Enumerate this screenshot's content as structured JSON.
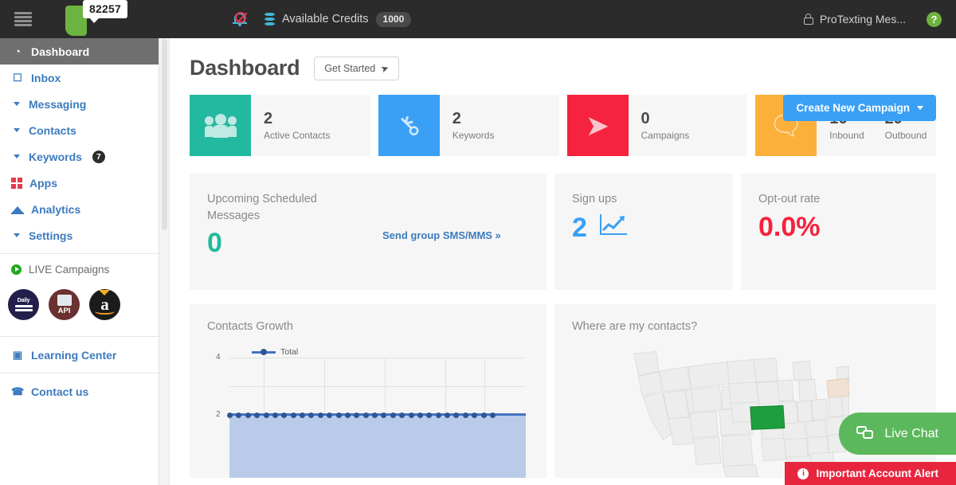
{
  "topbar": {
    "menu_icon": "hamburger-icon",
    "logo_tooltip": "82257",
    "notifications_icon": "bell-muted-icon",
    "credits_icon": "database-icon",
    "credits_label": "Available Credits",
    "credits_value": "1000",
    "account_icon": "lock-icon",
    "account_name": "ProTexting Mes...",
    "help_icon": "help-circle-icon",
    "help_label": "?"
  },
  "sidebar": {
    "items": [
      {
        "label": "Dashboard",
        "icon": "dashboard-icon",
        "active": true
      },
      {
        "label": "Inbox",
        "icon": "inbox-icon",
        "active": false
      },
      {
        "label": "Messaging",
        "icon": "caret-down-icon",
        "active": false
      },
      {
        "label": "Contacts",
        "icon": "caret-down-icon",
        "active": false
      },
      {
        "label": "Keywords",
        "icon": "caret-down-icon",
        "badge": "7",
        "active": false
      },
      {
        "label": "Apps",
        "icon": "apps-grid-icon",
        "active": false
      },
      {
        "label": "Analytics",
        "icon": "analytics-icon",
        "active": false
      },
      {
        "label": "Settings",
        "icon": "caret-down-icon",
        "active": false
      }
    ],
    "live_campaigns": {
      "title": "LIVE Campaigns",
      "icon": "play-circle-icon",
      "campaigns": [
        {
          "name": "daily-campaign-avatar",
          "label": "Daily"
        },
        {
          "name": "api-campaign-avatar",
          "label": "API"
        },
        {
          "name": "amazon-campaign-avatar",
          "label": "a"
        }
      ]
    },
    "learning_center": {
      "label": "Learning Center",
      "icon": "projector-icon"
    },
    "contact_us": {
      "label": "Contact us",
      "icon": "phone-icon"
    }
  },
  "main": {
    "title": "Dashboard",
    "get_started_label": "Get Started",
    "get_started_icon": "rocket-icon",
    "create_campaign_label": "Create New Campaign",
    "stats": [
      {
        "icon": "people-icon",
        "color": "#22b9a0",
        "value": "2",
        "label": "Active Contacts"
      },
      {
        "icon": "key-icon",
        "color": "#3aa0f5",
        "value": "2",
        "label": "Keywords"
      },
      {
        "icon": "paper-plane-icon",
        "color": "#f5233f",
        "value": "0",
        "label": "Campaigns"
      },
      {
        "icon": "chat-bubbles-icon",
        "color": "#fbb03b",
        "value_inbound": "16",
        "label_inbound": "Inbound",
        "value_outbound": "29",
        "label_outbound": "Outbound"
      }
    ],
    "scheduled": {
      "label": "Upcoming Scheduled Messages",
      "value": "0",
      "link_label": "Send group SMS/MMS »"
    },
    "signups": {
      "label": "Sign ups",
      "value": "2",
      "icon": "trend-up-icon"
    },
    "optout": {
      "label": "Opt-out rate",
      "value": "0.0%"
    },
    "growth_panel_title": "Contacts Growth",
    "map_panel_title": "Where are my contacts?"
  },
  "chart_data": {
    "type": "area",
    "title": "Contacts Growth",
    "xlabel": "",
    "ylabel": "",
    "ylim": [
      0,
      4
    ],
    "yticks": [
      2,
      4
    ],
    "grid": true,
    "legend_position": "top-left",
    "series": [
      {
        "name": "Total",
        "color": "#4472c4",
        "values": [
          2,
          2,
          2,
          2,
          2,
          2,
          2,
          2,
          2,
          2,
          2,
          2,
          2,
          2,
          2,
          2,
          2,
          2,
          2,
          2,
          2,
          2,
          2,
          2,
          2,
          2,
          2,
          2,
          2,
          2
        ]
      }
    ]
  },
  "map_data": {
    "type": "choropleth",
    "region": "United States",
    "highlighted": [
      {
        "state": "Kansas",
        "color": "#1e9e3d"
      },
      {
        "state": "New York",
        "color": "#f2e0d2"
      }
    ],
    "default_color": "#ededed"
  },
  "overlays": {
    "live_chat_label": "Live Chat",
    "live_chat_icon": "chat-icon",
    "alert_label": "Important Account Alert",
    "alert_icon": "info-icon",
    "alert_color": "#e8253f"
  }
}
